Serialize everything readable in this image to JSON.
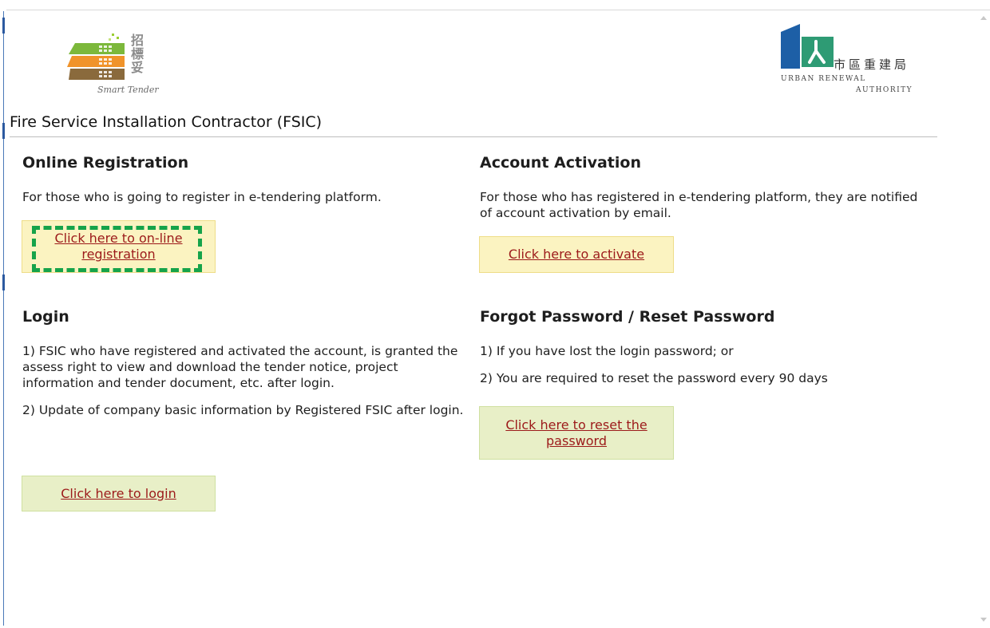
{
  "logos": {
    "smart_tender_cn": "招標妥",
    "smart_tender_en": "Smart Tender",
    "ura_cn": "市區重建局",
    "ura_en_line1": "URBAN RENEWAL",
    "ura_en_line2": "AUTHORITY"
  },
  "page": {
    "title": "Fire Service Installation Contractor (FSIC)"
  },
  "sections": {
    "online_registration": {
      "heading": "Online Registration",
      "text": "For those who is going to register in e-tendering platform.",
      "button": "Click here to on-line registration"
    },
    "account_activation": {
      "heading": "Account Activation",
      "text": "For those who has registered in e-tendering platform, they are notified of account activation by email.",
      "button": "Click here to activate"
    },
    "login": {
      "heading": "Login",
      "text1": "1) FSIC who have registered and activated the account, is granted the assess right to view and download the tender notice, project information and tender document, etc. after login.",
      "text2": "2) Update of company basic information by Registered FSIC after login.",
      "button": "Click here to login"
    },
    "forgot_password": {
      "heading": "Forgot Password / Reset Password",
      "text1": "1) If you have lost the login password; or",
      "text2": "2) You are required to reset the password every 90 days",
      "button": "Click here to reset the password"
    }
  },
  "colors": {
    "link": "#9c1a1a",
    "yellow_button": "#fbf3c1",
    "green_button": "#e8efc7",
    "highlight": "#16a34a",
    "ura_blue": "#1d5fa6",
    "ura_green": "#2e9b74"
  }
}
